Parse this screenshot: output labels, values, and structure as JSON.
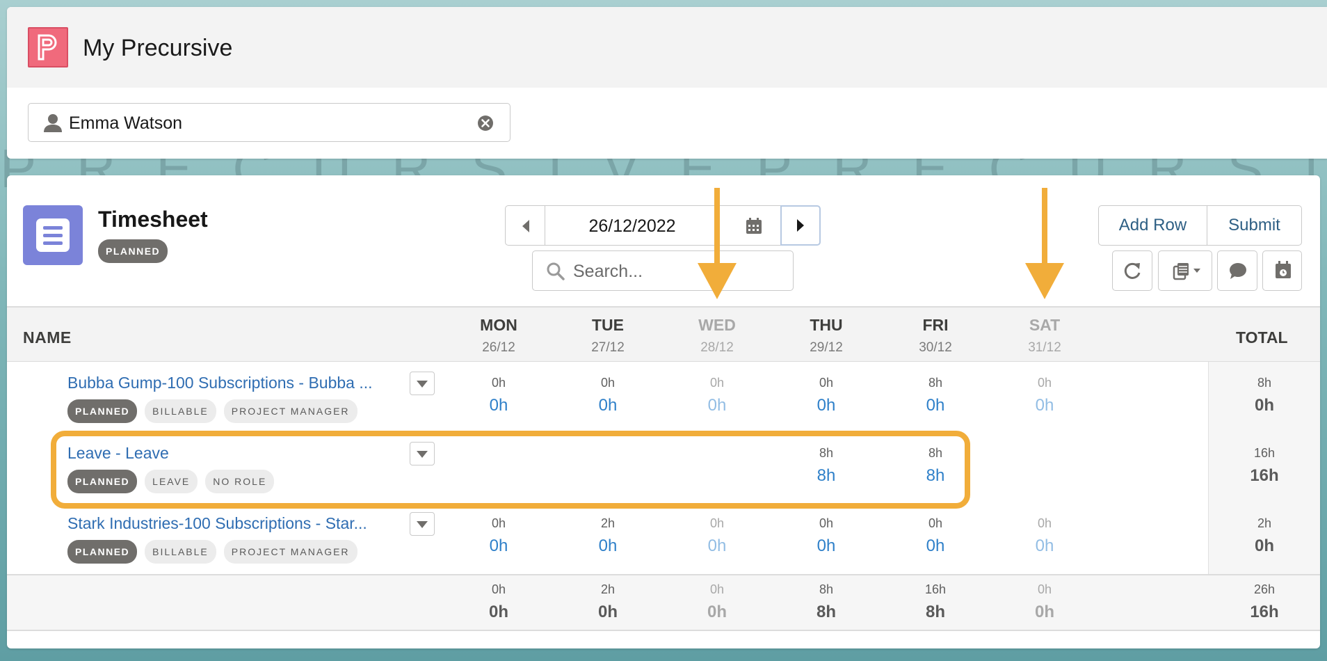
{
  "app": {
    "title": "My Precursive",
    "logo_letter": "P",
    "watermark": "PRECURSIVEPRECURSIVEPRECURSIVE"
  },
  "user_filter": {
    "value": "Emma Watson"
  },
  "timesheet": {
    "title": "Timesheet",
    "status": "PLANNED",
    "date": "26/12/2022",
    "search_placeholder": "Search...",
    "add_row_label": "Add Row",
    "submit_label": "Submit"
  },
  "grid": {
    "name_header": "NAME",
    "total_header": "TOTAL",
    "days": [
      {
        "name": "MON",
        "date": "26/12",
        "off": false
      },
      {
        "name": "TUE",
        "date": "27/12",
        "off": false
      },
      {
        "name": "WED",
        "date": "28/12",
        "off": true
      },
      {
        "name": "THU",
        "date": "29/12",
        "off": false
      },
      {
        "name": "FRI",
        "date": "30/12",
        "off": false
      },
      {
        "name": "SAT",
        "date": "31/12",
        "off": true
      }
    ],
    "rows": [
      {
        "name": "Bubba Gump-100 Subscriptions - Bubba ...",
        "tags": [
          "PLANNED",
          "BILLABLE",
          "PROJECT MANAGER"
        ],
        "planned": [
          "0h",
          "0h",
          "0h",
          "0h",
          "8h",
          "0h"
        ],
        "actual": [
          "0h",
          "0h",
          "0h",
          "0h",
          "0h",
          "0h"
        ],
        "total_planned": "8h",
        "total_actual": "0h"
      },
      {
        "name": "Leave - Leave",
        "tags": [
          "PLANNED",
          "LEAVE",
          "NO ROLE"
        ],
        "planned": [
          "",
          "",
          "",
          "8h",
          "8h",
          ""
        ],
        "actual": [
          "",
          "",
          "",
          "8h",
          "8h",
          ""
        ],
        "total_planned": "16h",
        "total_actual": "16h"
      },
      {
        "name": "Stark Industries-100 Subscriptions - Star...",
        "tags": [
          "PLANNED",
          "BILLABLE",
          "PROJECT MANAGER"
        ],
        "planned": [
          "0h",
          "2h",
          "0h",
          "0h",
          "0h",
          "0h"
        ],
        "actual": [
          "0h",
          "0h",
          "0h",
          "0h",
          "0h",
          "0h"
        ],
        "total_planned": "2h",
        "total_actual": "0h"
      }
    ],
    "footer": {
      "planned": [
        "0h",
        "2h",
        "0h",
        "8h",
        "16h",
        "0h"
      ],
      "actual": [
        "0h",
        "0h",
        "0h",
        "8h",
        "8h",
        "0h"
      ],
      "total_planned": "26h",
      "total_actual": "16h"
    }
  },
  "annotation": {
    "highlight_color": "#f1ad3a"
  }
}
